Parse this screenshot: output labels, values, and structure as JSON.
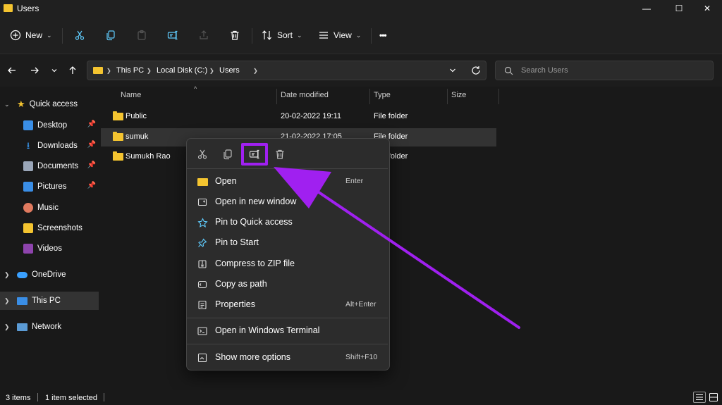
{
  "window": {
    "title": "Users",
    "minimize": "—",
    "maximize": "☐",
    "close": "✕"
  },
  "toolbar": {
    "new_label": "New",
    "sort_label": "Sort",
    "view_label": "View",
    "more_label": "•••"
  },
  "address": {
    "crumbs": [
      "This PC",
      "Local Disk (C:)",
      "Users"
    ]
  },
  "search": {
    "placeholder": "Search Users"
  },
  "sidebar": {
    "quick_access": "Quick access",
    "items": [
      "Desktop",
      "Downloads",
      "Documents",
      "Pictures",
      "Music",
      "Screenshots",
      "Videos"
    ],
    "onedrive": "OneDrive",
    "thispc": "This PC",
    "network": "Network"
  },
  "columns": {
    "name": "Name",
    "date": "Date modified",
    "type": "Type",
    "size": "Size"
  },
  "files": [
    {
      "name": "Public",
      "date": "20-02-2022 19:11",
      "type": "File folder"
    },
    {
      "name": "sumuk",
      "date": "21-02-2022 17:05",
      "type": "File folder"
    },
    {
      "name": "Sumukh Rao",
      "date": "",
      "type": "File folder"
    }
  ],
  "context_menu": {
    "items": [
      {
        "label": "Open",
        "shortcut": "Enter"
      },
      {
        "label": "Open in new window",
        "shortcut": ""
      },
      {
        "label": "Pin to Quick access",
        "shortcut": ""
      },
      {
        "label": "Pin to Start",
        "shortcut": ""
      },
      {
        "label": "Compress to ZIP file",
        "shortcut": ""
      },
      {
        "label": "Copy as path",
        "shortcut": ""
      },
      {
        "label": "Properties",
        "shortcut": "Alt+Enter"
      },
      {
        "label": "Open in Windows Terminal",
        "shortcut": ""
      },
      {
        "label": "Show more options",
        "shortcut": "Shift+F10"
      }
    ]
  },
  "status": {
    "count": "3 items",
    "selected": "1 item selected"
  },
  "colors": {
    "highlight": "#a020f0",
    "folder": "#f4c430",
    "accent": "#60cdff"
  }
}
